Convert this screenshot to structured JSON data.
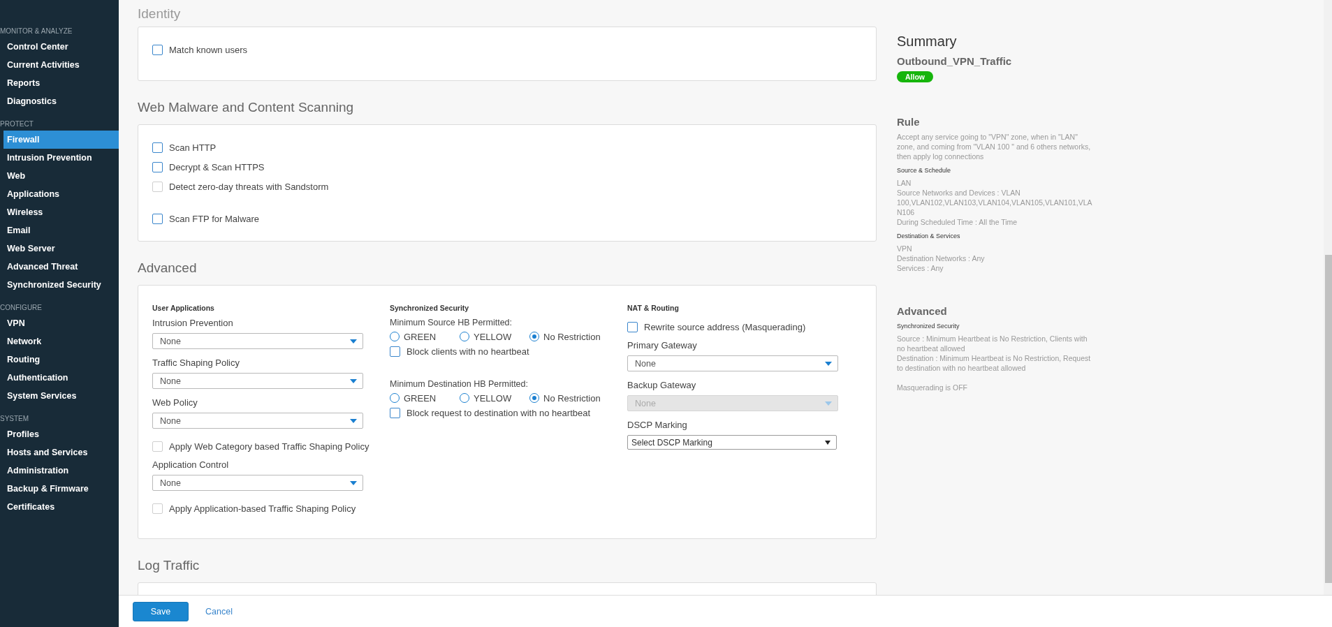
{
  "sidebar": {
    "sections": [
      {
        "title": "MONITOR & ANALYZE",
        "items": [
          {
            "label": "Control Center",
            "selected": false
          },
          {
            "label": "Current Activities",
            "selected": false
          },
          {
            "label": "Reports",
            "selected": false
          },
          {
            "label": "Diagnostics",
            "selected": false
          }
        ]
      },
      {
        "title": "PROTECT",
        "items": [
          {
            "label": "Firewall",
            "selected": true
          },
          {
            "label": "Intrusion Prevention",
            "selected": false
          },
          {
            "label": "Web",
            "selected": false
          },
          {
            "label": "Applications",
            "selected": false
          },
          {
            "label": "Wireless",
            "selected": false
          },
          {
            "label": "Email",
            "selected": false
          },
          {
            "label": "Web Server",
            "selected": false
          },
          {
            "label": "Advanced Threat",
            "selected": false
          },
          {
            "label": "Synchronized Security",
            "selected": false
          }
        ]
      },
      {
        "title": "CONFIGURE",
        "items": [
          {
            "label": "VPN",
            "selected": false
          },
          {
            "label": "Network",
            "selected": false
          },
          {
            "label": "Routing",
            "selected": false
          },
          {
            "label": "Authentication",
            "selected": false
          },
          {
            "label": "System Services",
            "selected": false
          }
        ]
      },
      {
        "title": "SYSTEM",
        "items": [
          {
            "label": "Profiles",
            "selected": false
          },
          {
            "label": "Hosts and Services",
            "selected": false
          },
          {
            "label": "Administration",
            "selected": false
          },
          {
            "label": "Backup & Firmware",
            "selected": false
          },
          {
            "label": "Certificates",
            "selected": false
          }
        ]
      }
    ]
  },
  "sections": [
    {
      "title": "Identity",
      "groups": [
        [
          {
            "label": "Match known users",
            "checked": false,
            "disabled": false
          }
        ]
      ]
    },
    {
      "title": "Web Malware and Content Scanning",
      "groups": [
        [
          {
            "label": "Scan HTTP",
            "checked": false,
            "disabled": false
          },
          {
            "label": "Decrypt & Scan HTTPS",
            "checked": false,
            "disabled": false
          },
          {
            "label": "Detect zero-day threats with Sandstorm",
            "checked": false,
            "disabled": true
          }
        ],
        [
          {
            "label": "Scan FTP for Malware",
            "checked": false,
            "disabled": false
          }
        ]
      ]
    }
  ],
  "advanced": {
    "title": "Advanced",
    "columns": [
      {
        "heading": "User Applications",
        "items": [
          {
            "kind": "select",
            "label": "Intrusion Prevention",
            "value": "None",
            "disabled": false
          },
          {
            "kind": "select",
            "label": "Traffic Shaping Policy",
            "value": "None",
            "disabled": false
          },
          {
            "kind": "select",
            "label": "Web Policy",
            "value": "None",
            "disabled": false
          },
          {
            "kind": "checkbox",
            "label": "Apply Web Category based Traffic Shaping Policy",
            "checked": false,
            "disabled": true
          },
          {
            "kind": "select",
            "label": "Application Control",
            "value": "None",
            "disabled": false
          },
          {
            "kind": "checkbox",
            "label": "Apply Application-based Traffic Shaping Policy",
            "checked": false,
            "disabled": true
          }
        ]
      },
      {
        "heading": "Synchronized Security",
        "items": [
          {
            "kind": "radios",
            "label": "Minimum Source HB Permitted:",
            "options": [
              {
                "label": "GREEN",
                "selected": false
              },
              {
                "label": "YELLOW",
                "selected": false
              },
              {
                "label": "No Restriction",
                "selected": true
              }
            ]
          },
          {
            "kind": "checkbox",
            "label": "Block clients with no heartbeat",
            "checked": false,
            "disabled": false
          },
          {
            "kind": "radios",
            "label": "Minimum Destination HB Permitted:",
            "options": [
              {
                "label": "GREEN",
                "selected": false
              },
              {
                "label": "YELLOW",
                "selected": false
              },
              {
                "label": "No Restriction",
                "selected": true
              }
            ]
          },
          {
            "kind": "checkbox",
            "label": "Block request to destination with no heartbeat",
            "checked": false,
            "disabled": false
          }
        ]
      },
      {
        "heading": "NAT & Routing",
        "items": [
          {
            "kind": "checkbox",
            "label": "Rewrite source address (Masquerading)",
            "checked": false,
            "disabled": false
          },
          {
            "kind": "select",
            "label": "Primary Gateway",
            "value": "None",
            "disabled": false
          },
          {
            "kind": "select",
            "label": "Backup Gateway",
            "value": "None",
            "disabled": true
          },
          {
            "kind": "plain_select",
            "label": "DSCP Marking",
            "value": "Select DSCP Marking",
            "disabled": false
          }
        ]
      }
    ]
  },
  "log_traffic": {
    "title": "Log Traffic"
  },
  "summary": {
    "title": "Summary",
    "rule_name": "Outbound_VPN_Traffic",
    "action": "Allow",
    "blocks": [
      {
        "title": "Rule",
        "description": "Accept any service going to \"VPN\" zone, when in \"LAN\" zone, and coming from \"VLAN 100 \" and 6 others networks, then apply log connections",
        "groups": [
          {
            "heading": "Source & Schedule",
            "lines": [
              "LAN",
              "Source Networks and Devices : VLAN 100,VLAN102,VLAN103,VLAN104,VLAN105,VLAN101,VLAN106",
              "During Scheduled Time : All the Time"
            ]
          },
          {
            "heading": "Destination & Services",
            "lines": [
              "VPN",
              "Destination Networks : Any",
              "Services : Any"
            ]
          }
        ]
      },
      {
        "title": "Advanced",
        "groups": [
          {
            "heading": "Synchronized Security",
            "lines": [
              "Source : Minimum Heartbeat is No Restriction, Clients with no heartbeat allowed",
              "Destination : Minimum Heartbeat is No Restriction, Request to destination with no heartbeat allowed"
            ]
          }
        ],
        "note": "Masquerading is OFF"
      }
    ]
  },
  "footer": {
    "save": "Save",
    "cancel": "Cancel"
  }
}
